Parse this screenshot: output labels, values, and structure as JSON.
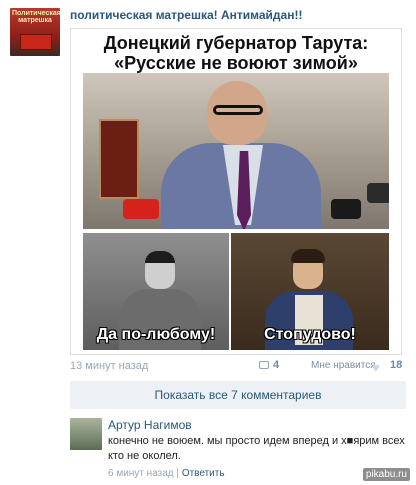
{
  "post": {
    "group_name": "политическая матрешка! Антимайдан!!",
    "avatar_text": "Политическая матрешка",
    "meme": {
      "headline_line1": "Донецкий губернатор Тарута:",
      "headline_line2": "«Русские не воюют зимой»",
      "left_caption": "Да по-любому!",
      "right_caption": "Стопудово!"
    },
    "time_ago": "13 минут назад",
    "comments_count": "4",
    "like_label": "Мне нравится",
    "like_count": "18"
  },
  "show_all_label": "Показать все 7 комментариев",
  "comment": {
    "author": "Артур Нагимов",
    "text": "конечно не воюем. мы просто идем вперед и х■ярим всех кто не околел.",
    "time": "6 минут назад",
    "separator": "|",
    "reply_label": "Ответить"
  },
  "watermark": "pikabu.ru"
}
